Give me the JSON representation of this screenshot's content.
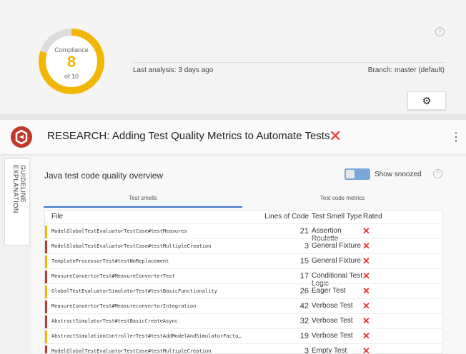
{
  "compliance": {
    "label": "Compliance",
    "score": "8",
    "total": "of 10",
    "fraction": 0.8
  },
  "header": {
    "last_analysis": "Last analysis: 3 days ago",
    "branch": "Branch: master (default)"
  },
  "project": {
    "title": "RESEARCH: Adding Test Quality Metrics to Automate Tests",
    "close": "✕",
    "menu": "⋮"
  },
  "sidebar": {
    "tab": "GUIDELINE EXPLANATION"
  },
  "panel": {
    "title": "Java test code quality overview",
    "show_snoozed": "Show snoozed",
    "tabs": [
      "Test smells",
      "Test code metrics"
    ],
    "columns": [
      "File",
      "Lines of Code",
      "Test Smell Type",
      "Rated"
    ],
    "rows": [
      {
        "file": "ModelGlobalTestEvaluatorTestCase#testMeasures",
        "loc": "21",
        "smell": "Assertion Roulette",
        "bar": "#f2b705"
      },
      {
        "file": "ModelGlobalTestEvaluatorTestCase#testMultipleCreation",
        "loc": "3",
        "smell": "General Fixture",
        "bar": "#c0392b"
      },
      {
        "file": "TemplateProcessorTest#testNoReplacement",
        "loc": "15",
        "smell": "General Fixture",
        "bar": "#f2b705"
      },
      {
        "file": "MeasureConvertorTest#MeasureConverterTest",
        "loc": "17",
        "smell": "Conditional Test Logic",
        "bar": "#c0392b"
      },
      {
        "file": "GlobalTestEvaluatorSimulatorTest#testBasicFunctionality",
        "loc": "26",
        "smell": "Eager Test",
        "bar": "#f2b705"
      },
      {
        "file": "MeasureConvertorTest#MeasureconvertorIntegration",
        "loc": "42",
        "smell": "Verbose Test",
        "bar": "#c0392b"
      },
      {
        "file": "AbstractSimulatorTest#testBasicCreateAsync",
        "loc": "32",
        "smell": "Verbose Test",
        "bar": "#c0392b"
      },
      {
        "file": "AbstractSimulationControllerTest#testAddModelAndSimulatorFacto…",
        "loc": "19",
        "smell": "Verbose Test",
        "bar": "#f2b705"
      },
      {
        "file": "ModelGlobalTestEvaluatorTestCase#testMultipleCreation",
        "loc": "3",
        "smell": "Empty Test",
        "bar": "#c0392b"
      }
    ]
  }
}
